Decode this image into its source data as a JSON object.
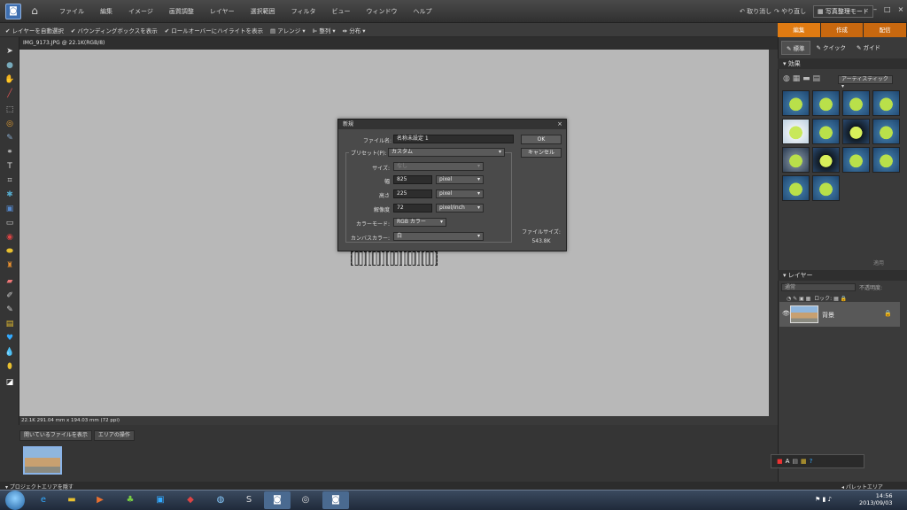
{
  "menubar": {
    "menus": [
      "ファイル",
      "編集",
      "イメージ",
      "画質調整",
      "レイヤー",
      "選択範囲",
      "フィルタ",
      "ビュー",
      "ウィンドウ",
      "ヘルプ"
    ],
    "undo_label": "取り消し",
    "redo_label": "やり直し",
    "organizer_label": "写真整理モード",
    "window_controls": [
      "–",
      "□",
      "×"
    ]
  },
  "options_bar": {
    "auto_select": "レイヤーを自動選択",
    "bounding_box": "バウンディングボックスを表示",
    "rollover": "ロールオーバーにハイライトを表示",
    "arrange": "アレンジ",
    "align": "整列",
    "distribute": "分布"
  },
  "mode_tabs": {
    "edit": "編集",
    "create": "作成",
    "share": "配信"
  },
  "edit_modes": {
    "standard": "標準",
    "quick": "クイック",
    "guide": "ガイド"
  },
  "document": {
    "tab_label": "IMG_9173.JPG @ 22.1K(RGB/8)",
    "status": "22.1K    291.04 mm x 194.03 mm (72 ppi)"
  },
  "dialog": {
    "title": "新規",
    "name_label": "ファイル名:",
    "name_value": "名称未設定 1",
    "preset_label": "プリセット(P):",
    "preset_value": "カスタム",
    "size_label": "サイズ:",
    "size_value": "なし",
    "width_label": "幅",
    "width_value": "825",
    "width_unit": "pixel",
    "height_label": "高さ",
    "height_value": "225",
    "height_unit": "pixel",
    "resolution_label": "解像度",
    "resolution_value": "72",
    "resolution_unit": "pixel/inch",
    "color_mode_label": "カラーモード:",
    "color_mode_value": "RGB カラー",
    "bg_label": "カンバスカラー:",
    "bg_value": "白",
    "ok_label": "OK",
    "cancel_label": "キャンセル",
    "filesize_label": "ファイルサイズ:",
    "filesize_value": "543.8K"
  },
  "project_bin": {
    "show_files": "開いているファイルを表示",
    "bin_actions": "エリアの操作",
    "hide_label": "プロジェクトエリアを隠す"
  },
  "effects_panel": {
    "title": "効果",
    "filter_value": "アーティスティック",
    "apply_label": "適用"
  },
  "layers_panel": {
    "title": "レイヤー",
    "blend_mode": "通常",
    "opacity_label": "不透明度:",
    "lock_label": "ロック:",
    "layer_name": "背景"
  },
  "palette_bin_label": "パレットエリア",
  "clock": {
    "time": "14:56",
    "date": "2013/09/03"
  },
  "colors": {
    "accent": "#e07b12",
    "canvas": "#b8b8b8",
    "panel": "#3a3a3a"
  }
}
